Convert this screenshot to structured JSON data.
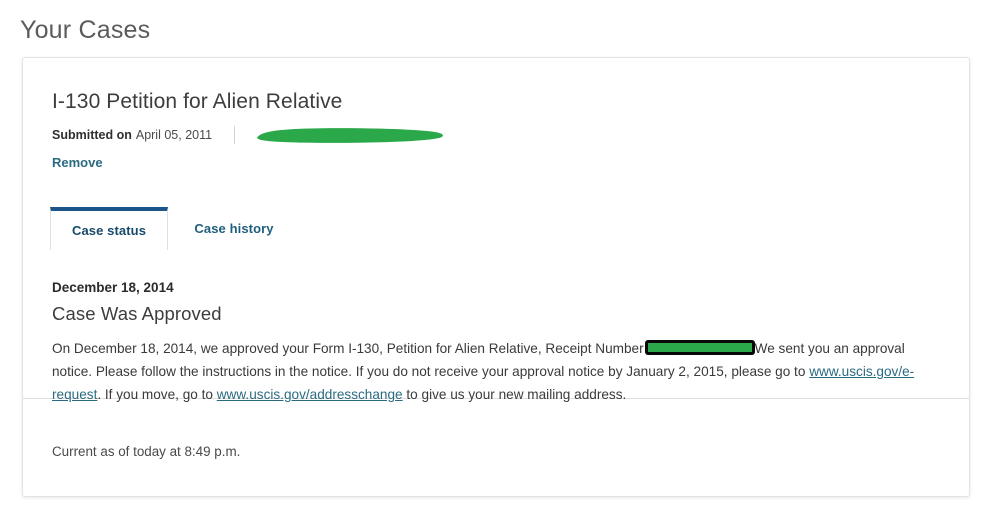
{
  "page": {
    "title": "Your Cases"
  },
  "case": {
    "title": "I-130 Petition for Alien Relative",
    "submitted_label": "Submitted on",
    "submitted_date": "April 05, 2011",
    "case_number_redacted": "",
    "remove_label": "Remove",
    "tabs": [
      {
        "label": "Case status",
        "active": true
      },
      {
        "label": "Case history",
        "active": false
      }
    ]
  },
  "status": {
    "date": "December 18, 2014",
    "headline": "Case Was Approved",
    "paragraph": {
      "part1": "On December 18, 2014, we approved your Form I-130, Petition for Alien Relative, Receipt Number",
      "receipt_redacted": "",
      "part2": "We sent you an approval notice. Please follow the instructions in the notice. If you do not receive your approval notice by January 2, 2015, please go to ",
      "link1_text": "www.uscis.gov/e-request",
      "part3": ". If you move, go to ",
      "link2_text": "www.uscis.gov/addresschange",
      "part4": " to give us your new mailing address."
    },
    "current_as_of": "Current as of today at 8:49 p.m."
  },
  "colors": {
    "accent_blue": "#1b5488",
    "link_teal": "#2b6b82",
    "redaction_green": "#2ba84a",
    "redaction_outline": "#080808",
    "card_border": "#e4e4e4",
    "text_primary": "#3a3a3a"
  }
}
